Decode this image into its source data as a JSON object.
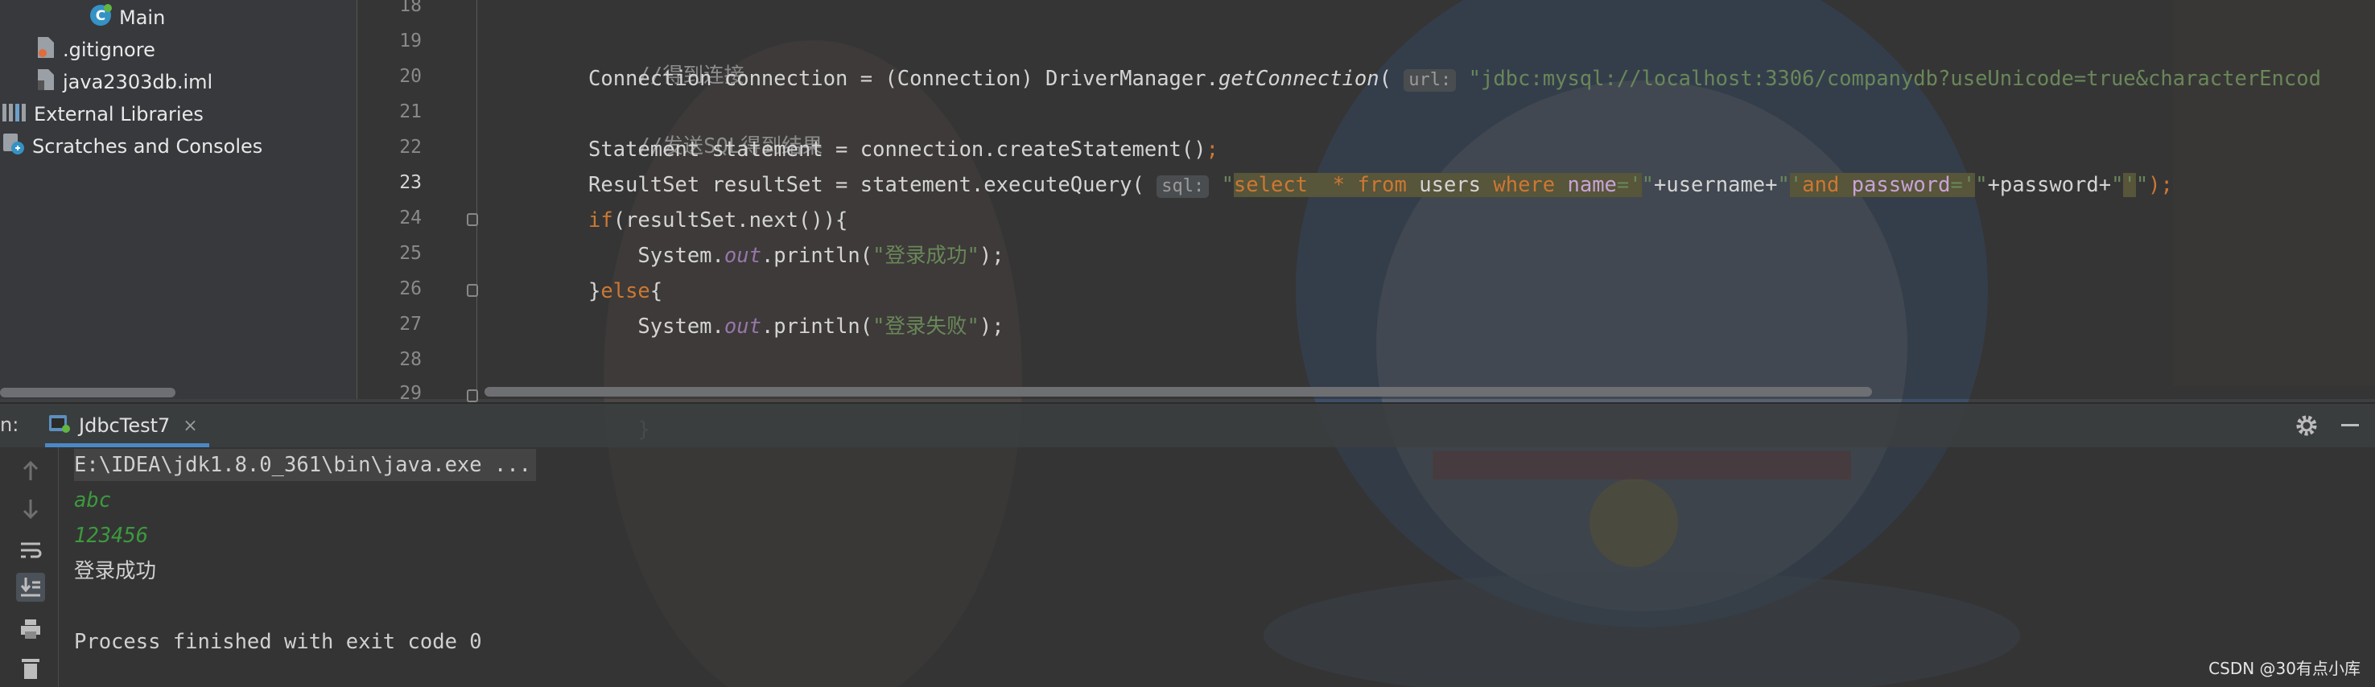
{
  "project_tree": {
    "items": [
      {
        "label": "Main",
        "icon": "java-class-icon"
      },
      {
        "label": ".gitignore",
        "icon": "gitignore-file-icon"
      },
      {
        "label": "java2303db.iml",
        "icon": "iml-file-icon"
      },
      {
        "label": "External Libraries",
        "icon": "libraries-icon"
      },
      {
        "label": "Scratches and Consoles",
        "icon": "scratches-icon"
      }
    ]
  },
  "editor": {
    "current_line": "23",
    "line_numbers": [
      "18",
      "19",
      "20",
      "21",
      "22",
      "23",
      "24",
      "25",
      "26",
      "27",
      "28",
      "29"
    ],
    "code": {
      "l19": "//得到连接",
      "l20_a": "Connection connection = (Connection) DriverManager.",
      "l20_b": "getConnection",
      "l20_c": "(",
      "l20_hint": "url:",
      "l20_str": "\"jdbc:mysql://localhost:3306/companydb?useUnicode=true&characterEncod",
      "l21": "//发送SQL得到结果",
      "l22_a": "Statement statement = connection.createStatement()",
      "l22_b": ";",
      "l23_a": "ResultSet resultSet = statement.executeQuery(",
      "l23_hint": "sql:",
      "l23_q1": "\"",
      "l23_s1": "select",
      "l23_s2": "  * ",
      "l23_s3": "from",
      "l23_s4": " users ",
      "l23_s5": "where",
      "l23_s6": " ",
      "l23_s7": "name",
      "l23_s8": "='",
      "l23_q2": "\"",
      "l23_mid1": "+username+",
      "l23_q3": "\"",
      "l23_s9": "'",
      "l23_s10": "and",
      "l23_s11": " ",
      "l23_s12": "password",
      "l23_s13": "='",
      "l23_q4": "\"",
      "l23_mid2": "+password+",
      "l23_q5": "\"",
      "l23_s14": "'",
      "l23_q6": "\"",
      "l23_end": ");",
      "l24_kw": "if",
      "l24_rest": "(resultSet.next()){",
      "l25_a": "    System.",
      "l25_out": "out",
      "l25_b": ".println(",
      "l25_str": "\"登录成功\"",
      "l25_c": ");",
      "l26_a": "}",
      "l26_kw": "else",
      "l26_b": "{",
      "l27_a": "    System.",
      "l27_out": "out",
      "l27_b": ".println(",
      "l27_str": "\"登录失败\"",
      "l27_c": ");",
      "l29": "}"
    }
  },
  "run_window": {
    "label": "n:",
    "tab_label": "JdbcTest7",
    "tab_close": "×",
    "console": {
      "command": "E:\\IDEA\\jdk1.8.0_361\\bin\\java.exe ...",
      "input1": "abc",
      "input2": "123456",
      "output1": "登录成功",
      "output2": "Process finished with exit code 0"
    },
    "toolbar_icons": [
      "up-arrow-icon",
      "down-arrow-icon",
      "soft-wrap-icon",
      "scroll-to-end-icon",
      "print-icon",
      "trash-icon"
    ]
  },
  "watermark": "CSDN @30有点小库",
  "colors": {
    "keyword": "#cc7832",
    "string": "#6a8759",
    "comment": "#8c8c8c",
    "static_field": "#9876aa",
    "console_input": "#3c9a3c",
    "tab_accent": "#4a88c7"
  }
}
